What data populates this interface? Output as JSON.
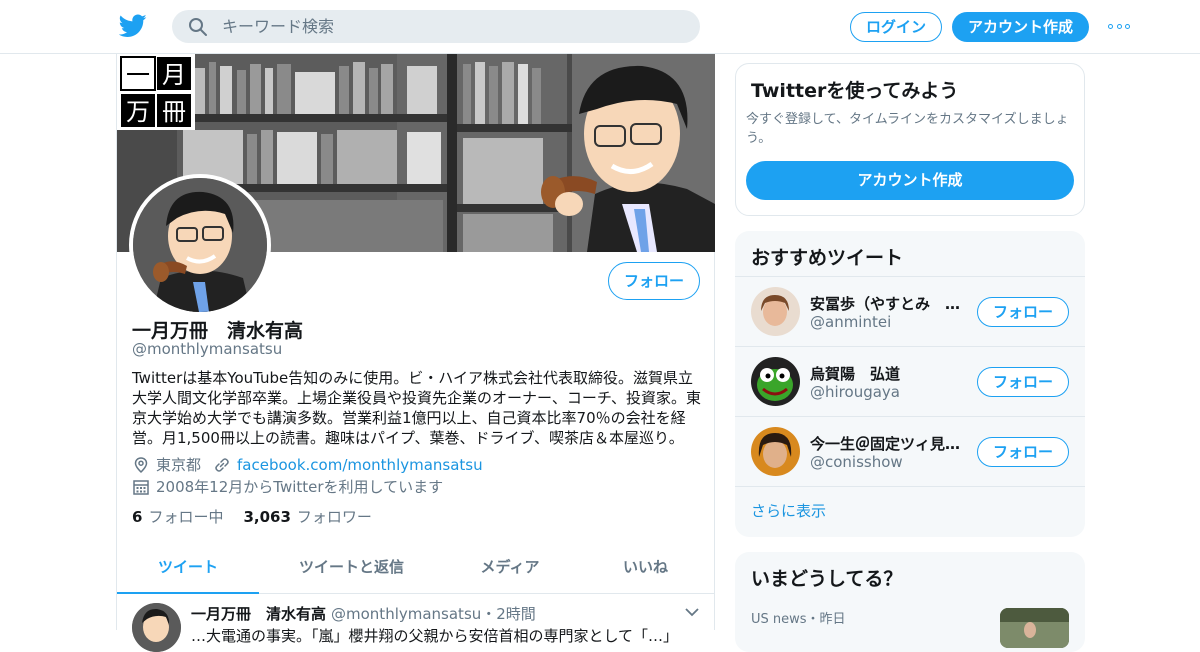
{
  "nav": {
    "search_placeholder": "キーワード検索",
    "login_label": "ログイン",
    "signup_label": "アカウント作成"
  },
  "banner": {
    "logo_chars": [
      "一",
      "月",
      "万",
      "冊"
    ]
  },
  "profile": {
    "name": "一月万冊　清水有高",
    "handle": "@monthlymansatsu",
    "follow_label": "フォロー",
    "bio": "Twitterは基本YouTube告知のみに使用。ビ・ハイア株式会社代表取締役。滋賀県立大学人間文化学部卒業。上場企業役員や投資先企業のオーナー、コーチ、投資家。東京大学始め大学でも講演多数。営業利益1億円以上、自己資本比率70％の会社を経営。月1,500冊以上の読書。趣味はパイプ、葉巻、ドライブ、喫茶店＆本屋巡り。",
    "location": "東京都",
    "url": "facebook.com/monthlymansatsu",
    "joined": "2008年12月からTwitterを利用しています",
    "following_count": "6",
    "following_label": "フォロー中",
    "followers_count": "3,063",
    "followers_label": "フォロワー"
  },
  "tabs": [
    {
      "label": "ツイート",
      "active": true
    },
    {
      "label": "ツイートと返信",
      "active": false
    },
    {
      "label": "メディア",
      "active": false
    },
    {
      "label": "いいね",
      "active": false
    }
  ],
  "tweet": {
    "name": "一月万冊　清水有高",
    "handle": "@monthlymansatsu",
    "time": "・2時間",
    "body_partial": "…大電通の事実。「嵐」櫻井翔の父親から安倍首相の専門家として「…」"
  },
  "signup_card": {
    "title": "Twitterを使ってみよう",
    "description": "今すぐ登録して、タイムラインをカスタマイズしましょう。",
    "button_label": "アカウント作成"
  },
  "who_to_follow": {
    "title": "おすすめツイート",
    "items": [
      {
        "name": "安冨歩（やすとみ　あゆみ）",
        "handle": "@anmintei",
        "follow_label": "フォロー",
        "avatar_color": "#c9a58a"
      },
      {
        "name": "烏賀陽　弘道",
        "handle": "@hirougaya",
        "follow_label": "フォロー",
        "avatar_color": "#3a9a2a"
      },
      {
        "name": "今一生＠固定ツィ見てね",
        "handle": "@conisshow",
        "follow_label": "フォロー",
        "avatar_color": "#c77a1e"
      }
    ],
    "show_more": "さらに表示"
  },
  "trends": {
    "title": "いまどうしてる？",
    "meta": "US news・昨日"
  },
  "colors": {
    "accent": "#1da1f2",
    "link": "#1b95e0",
    "secondary_text": "#657786",
    "border": "#e1e8ed"
  }
}
